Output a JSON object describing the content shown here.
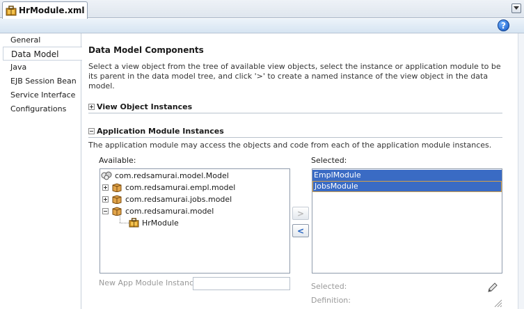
{
  "tab": {
    "label": "HrModule.xml"
  },
  "nav": {
    "items": [
      {
        "label": "General"
      },
      {
        "label": "Data Model"
      },
      {
        "label": "Java"
      },
      {
        "label": "EJB Session Bean"
      },
      {
        "label": "Service Interface"
      },
      {
        "label": "Configurations"
      }
    ],
    "selected": "Data Model"
  },
  "main": {
    "title": "Data Model Components",
    "description": "Select a view object from the tree of available view objects, select the instance or application module to be its parent in the data model tree, and click '>' to create a named instance of the view object in the data model.",
    "view_object_section": "View Object Instances",
    "app_module_section": "Application Module Instances",
    "app_module_desc": "The application module may access the objects and code from each of the application module instances.",
    "available_label": "Available:",
    "selected_label": "Selected:",
    "tree": {
      "root": "com.redsamurai.model.Model",
      "nodes": [
        {
          "label": "com.redsamurai.empl.model"
        },
        {
          "label": "com.redsamurai.jobs.model"
        },
        {
          "label": "com.redsamurai.model"
        }
      ],
      "leaf": "HrModule"
    },
    "selected_items": [
      "EmplModule",
      "JobsModule"
    ],
    "move_right_label": ">",
    "move_left_label": "<",
    "new_instance_label": "New App Module Instance:",
    "new_instance_value": "",
    "info_selected_label": "Selected:",
    "info_definition_label": "Definition:"
  },
  "help": {
    "glyph": "?"
  }
}
